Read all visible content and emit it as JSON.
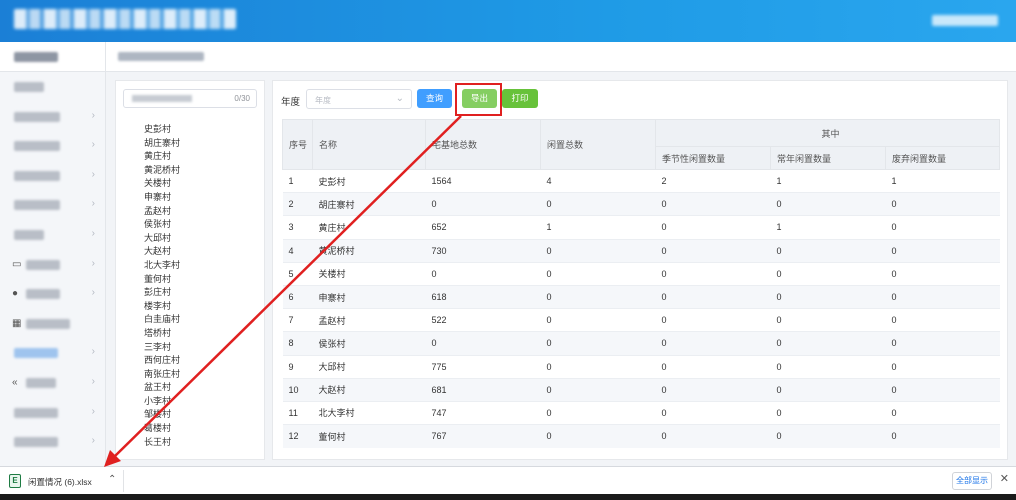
{
  "filter": {
    "year_label": "年度",
    "year_placeholder": "年度",
    "query_label": "查询",
    "export_label": "导出",
    "print_label": "打印"
  },
  "left": {
    "search_count": "0/30",
    "villages": [
      "史彭村",
      "胡庄寨村",
      "黄庄村",
      "黄泥桥村",
      "关楼村",
      "申寨村",
      "孟赵村",
      "侯张村",
      "大邱村",
      "大赵村",
      "北大李村",
      "董何村",
      "彭庄村",
      "楼李村",
      "白圭庙村",
      "塔桥村",
      "三李村",
      "西何庄村",
      "南张庄村",
      "盆王村",
      "小李村",
      "邹楼村",
      "葛楼村",
      "长王村"
    ]
  },
  "table": {
    "headers": {
      "no": "序号",
      "name": "名称",
      "total_homestead": "宅基地总数",
      "total_idle": "闲置总数",
      "of_which": "其中",
      "seasonal": "季节性闲置数量",
      "perennial": "常年闲置数量",
      "abandoned": "废弃闲置数量"
    },
    "rows": [
      {
        "no": "1",
        "name": "史彭村",
        "total": "1564",
        "idle": "4",
        "seasonal": "2",
        "perennial": "1",
        "abandoned": "1"
      },
      {
        "no": "2",
        "name": "胡庄寨村",
        "total": "0",
        "idle": "0",
        "seasonal": "0",
        "perennial": "0",
        "abandoned": "0"
      },
      {
        "no": "3",
        "name": "黄庄村",
        "total": "652",
        "idle": "1",
        "seasonal": "0",
        "perennial": "1",
        "abandoned": "0"
      },
      {
        "no": "4",
        "name": "黄泥桥村",
        "total": "730",
        "idle": "0",
        "seasonal": "0",
        "perennial": "0",
        "abandoned": "0"
      },
      {
        "no": "5",
        "name": "关楼村",
        "total": "0",
        "idle": "0",
        "seasonal": "0",
        "perennial": "0",
        "abandoned": "0"
      },
      {
        "no": "6",
        "name": "申寨村",
        "total": "618",
        "idle": "0",
        "seasonal": "0",
        "perennial": "0",
        "abandoned": "0"
      },
      {
        "no": "7",
        "name": "孟赵村",
        "total": "522",
        "idle": "0",
        "seasonal": "0",
        "perennial": "0",
        "abandoned": "0"
      },
      {
        "no": "8",
        "name": "侯张村",
        "total": "0",
        "idle": "0",
        "seasonal": "0",
        "perennial": "0",
        "abandoned": "0"
      },
      {
        "no": "9",
        "name": "大邱村",
        "total": "775",
        "idle": "0",
        "seasonal": "0",
        "perennial": "0",
        "abandoned": "0"
      },
      {
        "no": "10",
        "name": "大赵村",
        "total": "681",
        "idle": "0",
        "seasonal": "0",
        "perennial": "0",
        "abandoned": "0"
      },
      {
        "no": "11",
        "name": "北大李村",
        "total": "747",
        "idle": "0",
        "seasonal": "0",
        "perennial": "0",
        "abandoned": "0"
      },
      {
        "no": "12",
        "name": "董何村",
        "total": "767",
        "idle": "0",
        "seasonal": "0",
        "perennial": "0",
        "abandoned": "0"
      }
    ]
  },
  "download": {
    "filename": "闲置情况 (6).xlsx",
    "show_all": "全部显示",
    "file_badge": "E"
  },
  "icons": {
    "select_chevron": "chevron-down-icon",
    "download_caret": "chevron-up-icon",
    "close": "close-icon",
    "annotation": "red-arrow"
  },
  "colors": {
    "header_blue": "#1f8fe0",
    "query_button": "#409eff",
    "export_button": "#85ce61",
    "print_button": "#67c23a",
    "annotation_red": "#e02020"
  }
}
